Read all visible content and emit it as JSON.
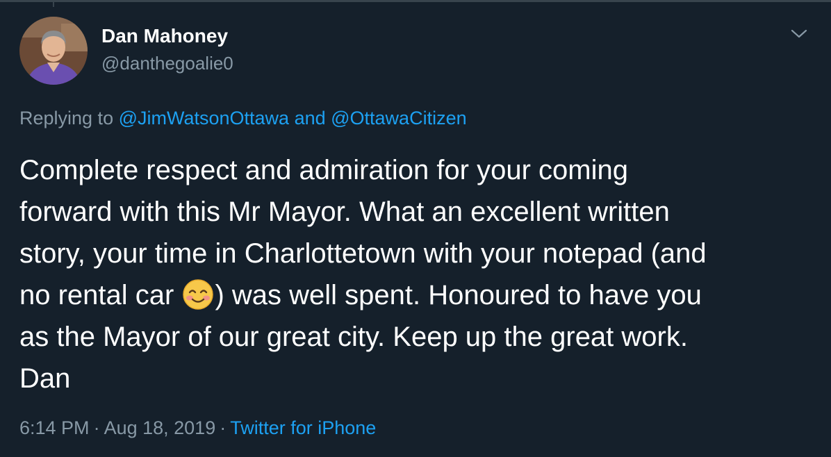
{
  "author": {
    "name": "Dan Mahoney",
    "handle": "@danthegoalie0"
  },
  "reply": {
    "prefix": "Replying to ",
    "mention_1": "@JimWatsonOttawa",
    "conjunction": " and ",
    "mention_2": "@OttawaCitizen"
  },
  "body": {
    "line_1": "Complete respect and admiration for your coming",
    "line_2": "forward with this Mr Mayor. What an excellent written",
    "line_3": "story, your time in Charlottetown with your notepad (and",
    "line_4_before_emoji": "no rental car ",
    "emoji": "smiling-face-with-smiling-eyes",
    "line_4_after_emoji": ") was well spent. Honoured to have you",
    "line_5": "as the Mayor of our great city.  Keep up the great work.",
    "line_6": "Dan"
  },
  "meta": {
    "time": "6:14 PM",
    "separator": "·",
    "date": "Aug 18, 2019",
    "source": "Twitter for iPhone"
  },
  "colors": {
    "background": "#15202b",
    "text": "#ffffff",
    "secondary": "#8899a6",
    "link": "#1da1f2",
    "border": "#38444d"
  }
}
